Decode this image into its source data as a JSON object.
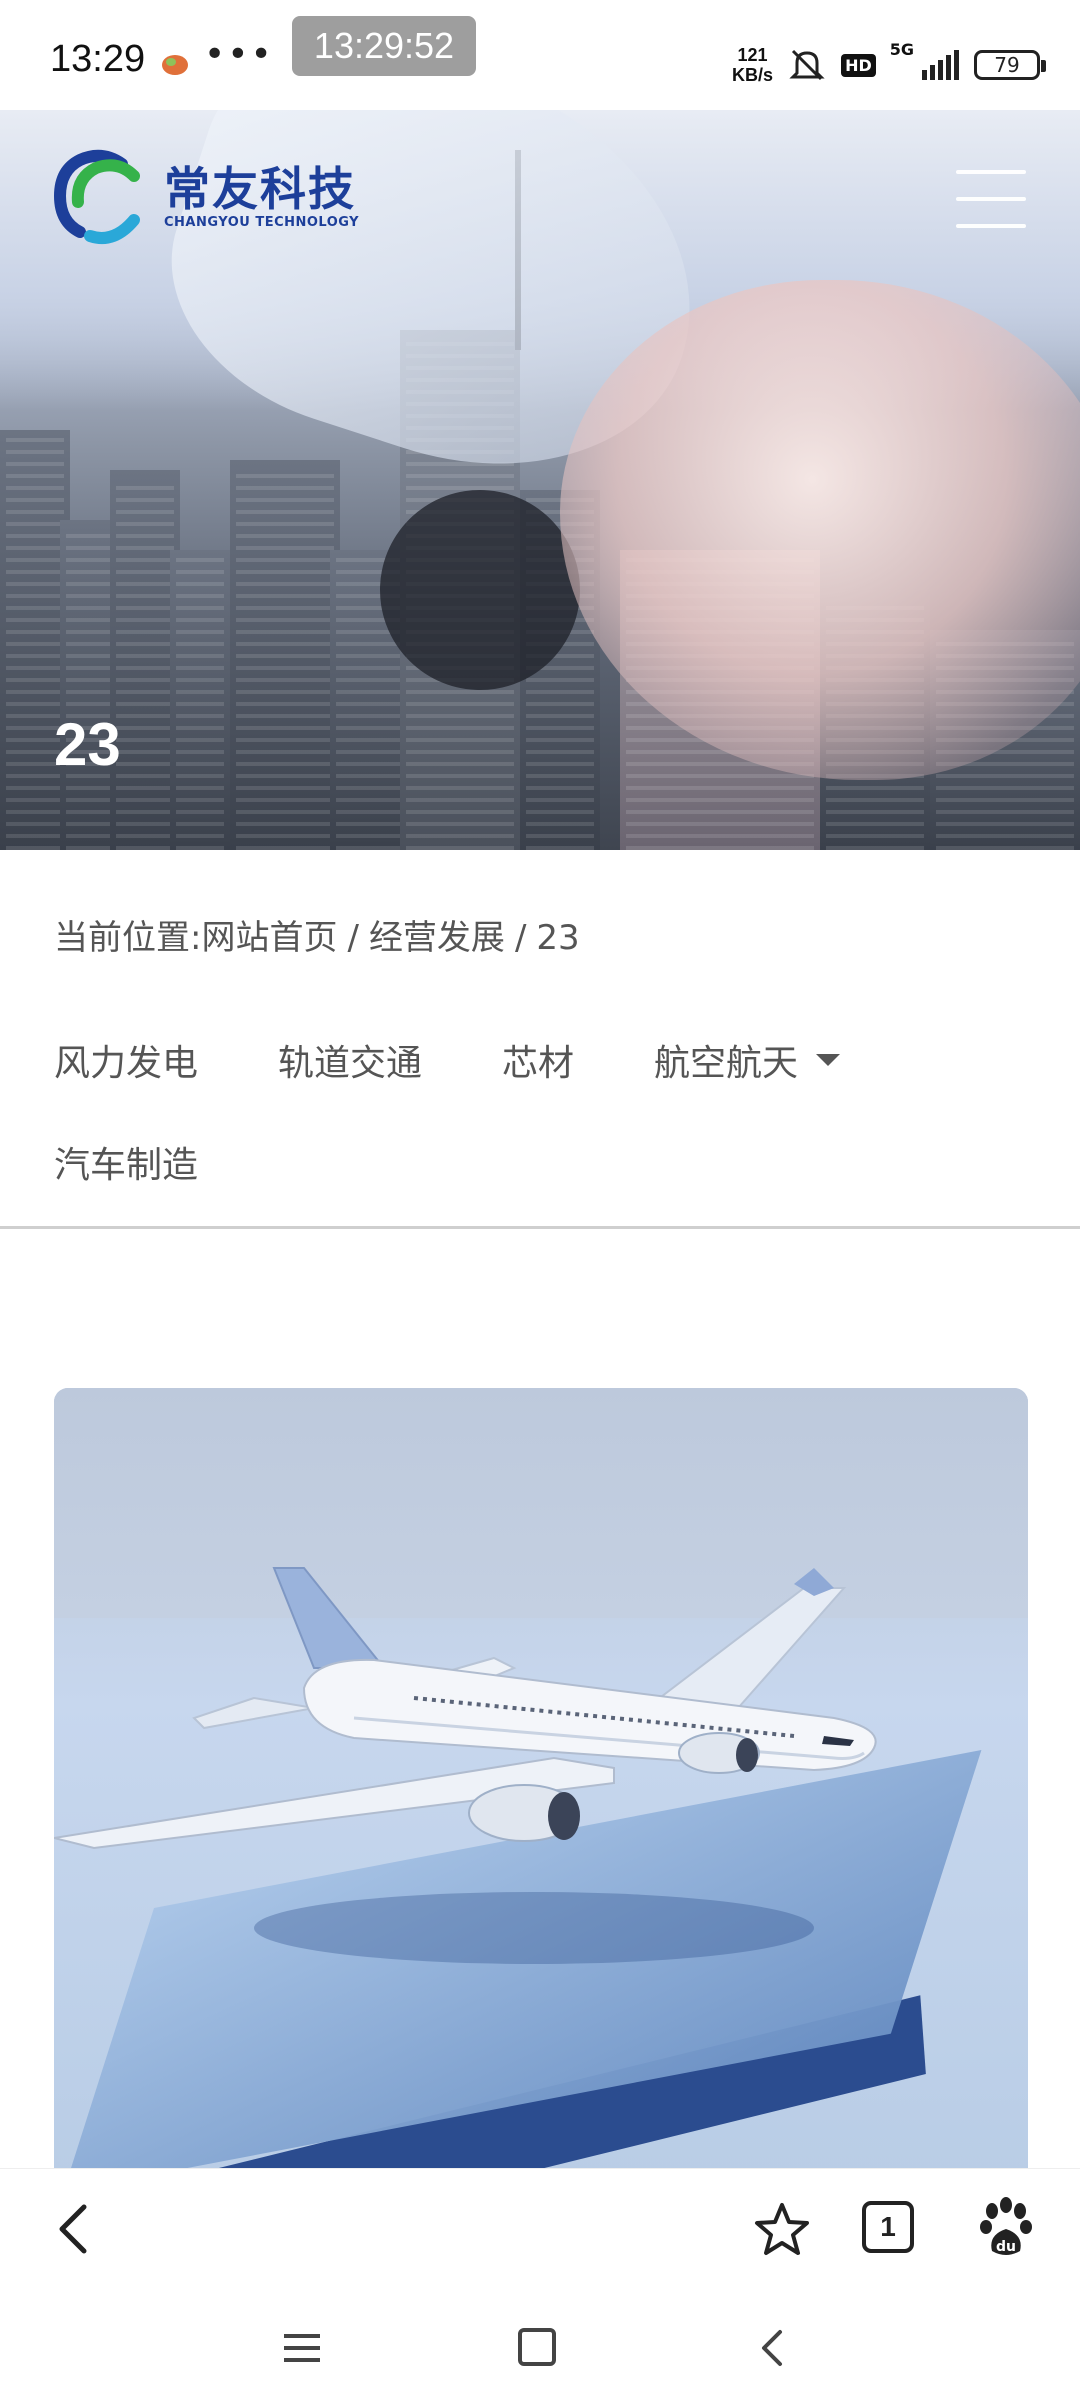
{
  "status_bar": {
    "time": "13:29",
    "more": "•••",
    "clock_overlay": "13:29:52",
    "net_speed_value": "121",
    "net_speed_unit": "KB/s",
    "hd_label": "HD",
    "network_label": "5G",
    "battery": "79"
  },
  "header": {
    "logo_cn": "常友科技",
    "logo_en": "CHANGYOU TECHNOLOGY"
  },
  "hero": {
    "title": "23"
  },
  "breadcrumb": {
    "prefix": "当前位置:",
    "items": [
      "网站首页",
      "经营发展",
      "23"
    ],
    "separator": "/"
  },
  "categories": {
    "row1": [
      "风力发电",
      "轨道交通",
      "芯材",
      "航空航天"
    ],
    "row2": [
      "汽车制造"
    ]
  },
  "browser_bar": {
    "tab_count": "1"
  },
  "colors": {
    "logo_blue": "#1d3f9a",
    "logo_green": "#35b24a",
    "logo_cyan": "#2aa8d8",
    "divider": "#cfcfcf"
  },
  "icons": [
    "app-notification-icon",
    "mute-icon",
    "signal-icon",
    "battery-icon",
    "menu-icon",
    "chevron-down-icon",
    "back-icon",
    "star-icon",
    "tabs-icon",
    "baidu-paw-icon",
    "home-icon"
  ]
}
